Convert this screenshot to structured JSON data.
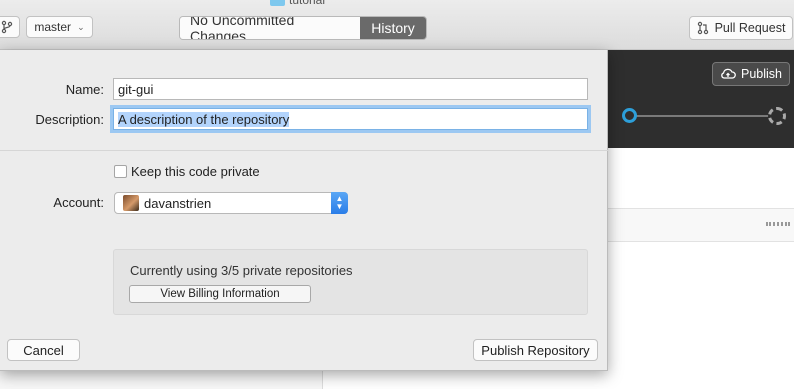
{
  "window": {
    "folder_title": "tutorial"
  },
  "toolbar": {
    "branch_label": "master",
    "tabs": [
      {
        "label": "No Uncommitted Changes",
        "selected": false
      },
      {
        "label": "History",
        "selected": true
      }
    ],
    "pull_request_label": "Pull Request"
  },
  "background": {
    "publish_label": "Publish"
  },
  "dialog": {
    "name_label": "Name:",
    "name_value": "git-gui",
    "description_label": "Description:",
    "description_value": "A description of the repository",
    "private_label": "Keep this code private",
    "private_checked": false,
    "account_label": "Account:",
    "account_value": "davanstrien",
    "usage_text": "Currently using 3/5 private repositories",
    "billing_button": "View Billing Information",
    "cancel_button": "Cancel",
    "publish_button": "Publish Repository"
  },
  "colors": {
    "accent": "#2d9fd9",
    "selected_tab": "#6a6a6a",
    "dark_band": "#2e2e2e",
    "focus_ring": "#9cc8f2"
  }
}
